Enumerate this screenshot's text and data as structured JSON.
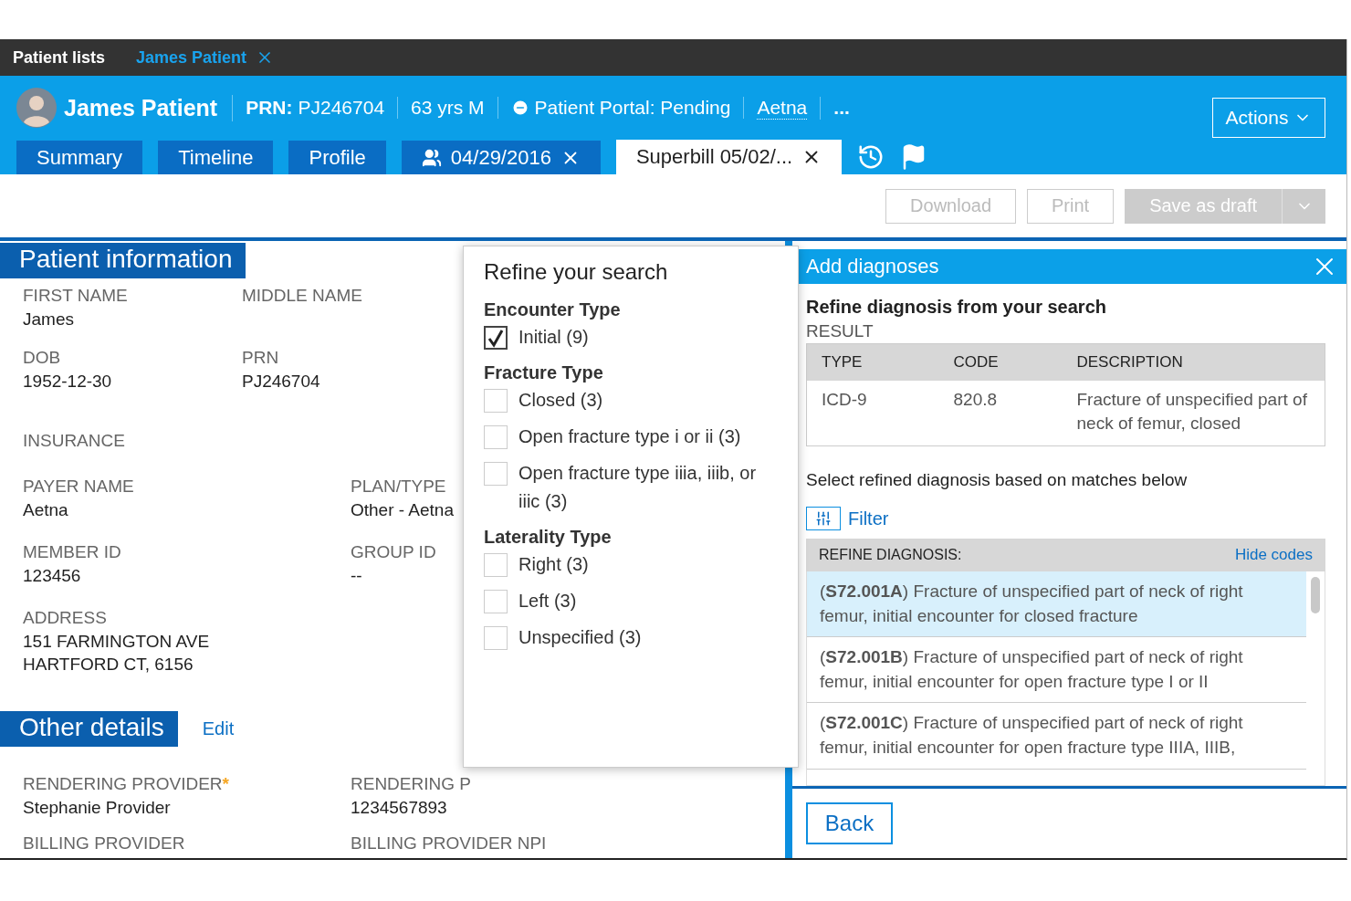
{
  "top_tabs": [
    {
      "label": "Patient lists",
      "selected": false
    },
    {
      "label": "James Patient",
      "selected": true,
      "closable": true
    }
  ],
  "patient": {
    "name": "James Patient",
    "prn_label": "PRN:",
    "prn": "PJ246704",
    "age_sex": "63 yrs M",
    "portal": "Patient Portal: Pending",
    "insurer": "Aetna",
    "more": "..."
  },
  "actions_button": "Actions",
  "record_tabs": [
    {
      "label": "Summary",
      "selected": false,
      "kind": "plain"
    },
    {
      "label": "Timeline",
      "selected": false,
      "kind": "plain"
    },
    {
      "label": "Profile",
      "selected": false,
      "kind": "plain"
    },
    {
      "label": "04/29/2016",
      "selected": false,
      "kind": "encounter",
      "closable": true
    },
    {
      "label": "Superbill 05/02/...",
      "selected": true,
      "kind": "plain",
      "closable": true
    }
  ],
  "toolbar": [
    {
      "label": "Download",
      "disabled": true,
      "kind": "outline"
    },
    {
      "label": "Print",
      "disabled": true,
      "kind": "outline"
    },
    {
      "label": "Save as draft",
      "disabled": true,
      "kind": "split"
    }
  ],
  "patient_information": {
    "title": "Patient information",
    "identity": [
      [
        {
          "label": "FIRST NAME",
          "value": "James"
        },
        {
          "label": "MIDDLE NAME"
        }
      ],
      [
        {
          "label": "DOB",
          "value": "1952-12-30"
        },
        {
          "label": "PRN",
          "value": "PJ246704"
        }
      ]
    ],
    "insurance_title": "INSURANCE",
    "insurance": [
      [
        {
          "label": "PAYER NAME",
          "value": "Aetna"
        },
        {
          "label": "PLAN/TYPE",
          "value": "Other - Aetna"
        }
      ],
      [
        {
          "label": "MEMBER ID",
          "value": "123456"
        },
        {
          "label": "GROUP ID",
          "value": "--"
        }
      ],
      [
        {
          "label": "ADDRESS",
          "value": "151 FARMINGTON AVE\nHARTFORD CT, 6156"
        }
      ]
    ]
  },
  "other_details": {
    "title": "Other details",
    "edit_link": "Edit",
    "fields": [
      [
        {
          "label": "RENDERING PROVIDER",
          "required_mark": "*",
          "value": "Stephanie Provider"
        },
        {
          "label": "RENDERING P",
          "value": "1234567893"
        }
      ],
      [
        {
          "label": "BILLING PROVIDER"
        },
        {
          "label": "BILLING PROVIDER NPI"
        }
      ]
    ]
  },
  "refine_popup": {
    "title": "Refine your search",
    "groups": [
      {
        "heading": "Encounter Type",
        "options": [
          {
            "label": "Initial (9)",
            "checked": true
          }
        ]
      },
      {
        "heading": "Fracture Type",
        "options": [
          {
            "label": "Closed (3)",
            "checked": false
          },
          {
            "label": "Open fracture type i or ii (3)",
            "checked": false
          },
          {
            "label": "Open fracture type iiia, iiib, or iiic (3)",
            "checked": false
          }
        ]
      },
      {
        "heading": "Laterality Type",
        "options": [
          {
            "label": "Right (3)",
            "checked": false
          },
          {
            "label": "Left (3)",
            "checked": false
          },
          {
            "label": "Unspecified (3)",
            "checked": false
          }
        ]
      }
    ]
  },
  "drawer": {
    "title": "Add diagnoses",
    "subtitle": "Refine diagnosis from your search",
    "result_label": "RESULT",
    "columns": [
      "TYPE",
      "CODE",
      "DESCRIPTION"
    ],
    "rows": [
      [
        "ICD-9",
        "820.8",
        "Fracture of unspecified part of neck of femur, closed"
      ]
    ],
    "instruction": "Select refined diagnosis based on matches below",
    "filter_label": "Filter",
    "refine_header": "REFINE DIAGNOSIS:",
    "hide_codes": "Hide codes",
    "items": [
      {
        "text": "(**S72.001A**) Fracture of unspecified part of neck of right femur, initial encounter for closed fracture",
        "selected": true
      },
      {
        "text": "(**S72.001B**) Fracture of unspecified part of neck of right femur, initial encounter for open fracture type I or II",
        "selected": false
      },
      {
        "text": "(**S72.001C**) Fracture of unspecified part of neck of right femur, initial encounter for open fracture type IIIA, IIIB,",
        "selected": false
      }
    ],
    "back_button": "Back"
  }
}
